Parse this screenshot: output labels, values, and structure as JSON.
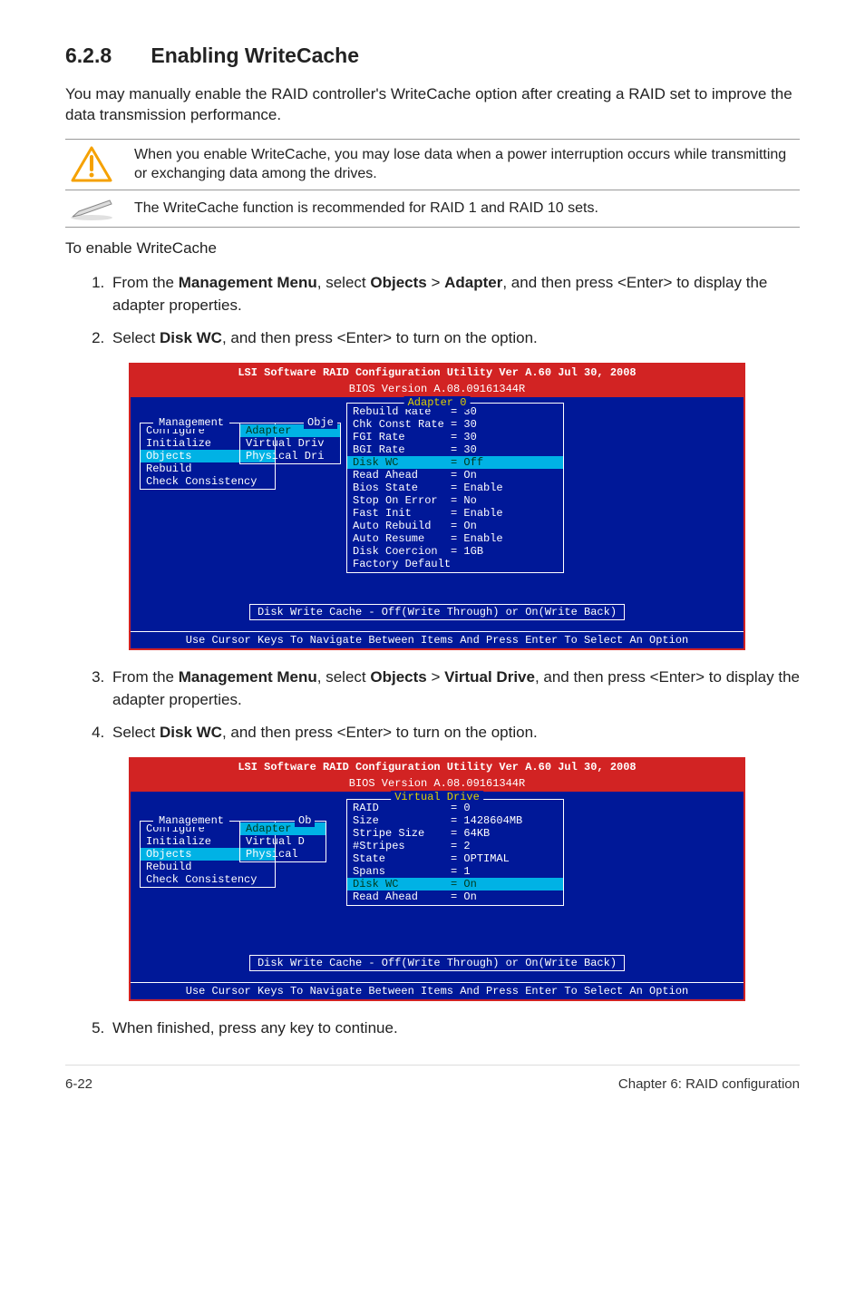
{
  "section": {
    "number": "6.2.8",
    "title": "Enabling WriteCache"
  },
  "intro": "You may manually enable the RAID controller's WriteCache option after creating a RAID set to improve the data transmission performance.",
  "warning": "When you enable WriteCache, you may lose data when a power interruption occurs while transmitting or exchanging data among the drives.",
  "note": "The WriteCache function is recommended for RAID 1 and RAID 10 sets.",
  "procedure_title": "To enable WriteCache",
  "steps": {
    "s1a": "From the ",
    "s1_mgmt": "Management Menu",
    "s1b": ", select ",
    "s1_obj": "Objects",
    "s1c": " > ",
    "s1_ad": "Adapter",
    "s1d": ", and then press <Enter> to display the adapter properties.",
    "s2a": "Select ",
    "s2_dwc": "Disk WC",
    "s2b": ", and then press <Enter> to turn on the option.",
    "s3a": "From the ",
    "s3_mgmt": "Management Menu",
    "s3b": ", select ",
    "s3_obj": "Objects",
    "s3c": " > ",
    "s3_vd": "Virtual Drive",
    "s3d": ", and then press <Enter> to display the adapter properties.",
    "s4a": "Select ",
    "s4_dwc": "Disk WC",
    "s4b": ", and then press <Enter> to turn on the option.",
    "s5": "When finished, press any key to continue."
  },
  "bios": {
    "title": "LSI Software RAID Configuration Utility Ver A.60 Jul 30, 2008",
    "version": "BIOS Version   A.08.09161344R",
    "mgmt_label": "Management",
    "mgmt": [
      "Configure",
      "Initialize",
      "Objects",
      "Rebuild",
      "Check Consistency"
    ],
    "sub1_label": "Obje",
    "sub1": {
      "sel": "Adapter",
      "rows": [
        "Virtual Driv",
        "Physical Dri"
      ]
    },
    "panel1_title": "Adapter 0",
    "adapter_props": [
      {
        "k": "Rebuild Rate",
        "v": "= 30"
      },
      {
        "k": "Chk Const Rate",
        "v": "= 30"
      },
      {
        "k": "FGI Rate",
        "v": "= 30"
      },
      {
        "k": "BGI Rate",
        "v": "= 30"
      },
      {
        "k": "Disk WC",
        "v": "= Off",
        "sel": true
      },
      {
        "k": "Read Ahead",
        "v": "= On"
      },
      {
        "k": "Bios State",
        "v": "= Enable"
      },
      {
        "k": "Stop On Error",
        "v": "= No"
      },
      {
        "k": "Fast Init",
        "v": "= Enable"
      },
      {
        "k": "Auto Rebuild",
        "v": "= On"
      },
      {
        "k": "Auto Resume",
        "v": "= Enable"
      },
      {
        "k": "Disk Coercion",
        "v": "= 1GB"
      },
      {
        "k": "Factory Default",
        "v": ""
      }
    ],
    "status": "Disk Write Cache - Off(Write Through) or On(Write Back)",
    "help": "Use Cursor Keys To Navigate Between Items And Press Enter To Select An Option",
    "sub2_label": "Ob",
    "sub2": {
      "sel": "Adapter",
      "rows": [
        "Virtual D",
        "Physical"
      ]
    },
    "panel2_title": "Virtual Drive",
    "vd_props": [
      {
        "k": "RAID",
        "v": "= 0"
      },
      {
        "k": "Size",
        "v": "= 1428604MB"
      },
      {
        "k": "Stripe Size",
        "v": "= 64KB"
      },
      {
        "k": "#Stripes",
        "v": "= 2"
      },
      {
        "k": "State",
        "v": "= OPTIMAL"
      },
      {
        "k": "Spans",
        "v": "= 1"
      },
      {
        "k": "Disk WC",
        "v": "= On",
        "sel": true
      },
      {
        "k": "Read Ahead",
        "v": "= On"
      }
    ]
  },
  "footer": {
    "left": "6-22",
    "right": "Chapter 6: RAID configuration"
  }
}
